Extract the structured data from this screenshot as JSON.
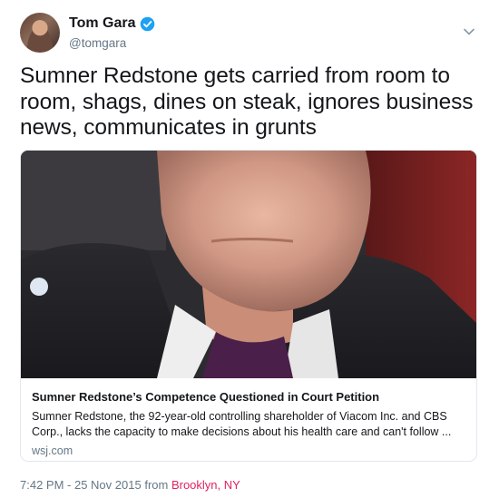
{
  "author": {
    "name": "Tom Gara",
    "handle": "@tomgara",
    "verified_icon": "verified-badge-icon",
    "avatar": "avatar"
  },
  "menu": {
    "icon": "chevron-down-icon"
  },
  "tweet": {
    "text": "Sumner Redstone gets carried from room to room, shags, dines on steak, ignores business news, communicates in grunts"
  },
  "card": {
    "image_description_icon": "photo",
    "title": "Sumner Redstone’s Competence Questioned in Court Petition",
    "description": "Sumner Redstone, the 92-year-old controlling shareholder of Viacom Inc. and CBS Corp., lacks the capacity to make decisions about his health care and can't follow ...",
    "domain": "wsj.com"
  },
  "meta": {
    "timestamp": "7:42 PM - 25 Nov 2015",
    "from_label": "from",
    "location": "Brooklyn, NY"
  },
  "colors": {
    "verified_blue": "#1da1f2",
    "secondary_text": "#657786",
    "location_link": "#e0245e",
    "card_border": "#e1e8ed"
  }
}
